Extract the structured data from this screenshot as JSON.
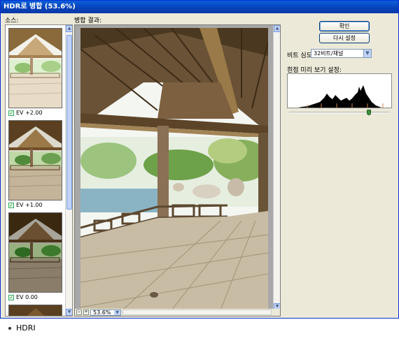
{
  "window": {
    "title": "HDR로 병합 (53.6%)"
  },
  "source": {
    "label": "소스:",
    "items": [
      {
        "caption": "EV +2.00",
        "checked": true
      },
      {
        "caption": "EV +1.00",
        "checked": true
      },
      {
        "caption": "EV 0.00",
        "checked": true
      }
    ]
  },
  "preview": {
    "label": "병합 결과:",
    "zoom": "53.6%"
  },
  "controls": {
    "ok_label": "확인",
    "reset_label": "다시 설정",
    "bit_depth_label": "비트 심도:",
    "bit_depth_value": "32비트/채널",
    "white_point_label": "흰점 미리 보기 설정:"
  },
  "caption": {
    "text": "HDRI"
  },
  "colors": {
    "titlebar": "#0a3aa8",
    "panel": "#ece9d8",
    "slider_thumb": "#3c8f3c"
  }
}
